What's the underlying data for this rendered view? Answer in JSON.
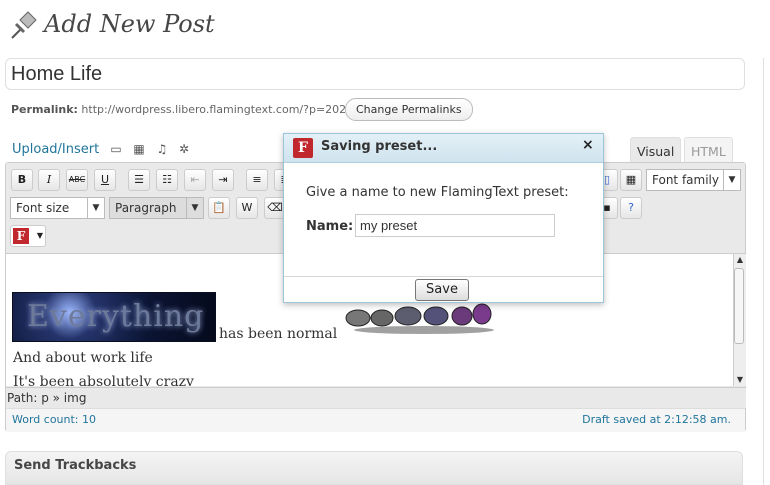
{
  "page": {
    "title": "Add New Post"
  },
  "post": {
    "title_value": "Home Life"
  },
  "permalink": {
    "label": "Permalink:",
    "url": "http://wordpress.libero.flamingtext.com/?p=202",
    "change_button": "Change Permalinks"
  },
  "media": {
    "upload_label": "Upload/Insert",
    "icons": [
      "image-icon",
      "video-icon",
      "audio-icon",
      "media-icon"
    ]
  },
  "tabs": {
    "visual": "Visual",
    "html": "HTML"
  },
  "toolbar": {
    "row1": [
      "B",
      "I",
      "ABC",
      "U"
    ],
    "font_family": "Font family",
    "font_size": "Font size",
    "format": "Paragraph"
  },
  "content": {
    "line1_suffix": "has been normal",
    "line2": "And about work life",
    "line3": "It's been absolutely crazy",
    "image_text": "Everything"
  },
  "pathbar": {
    "text": "Path: p » img"
  },
  "status": {
    "word_count": "Word count: 10",
    "draft_saved": "Draft saved at 2:12:58 am."
  },
  "trackbacks": {
    "title": "Send Trackbacks"
  },
  "dialog": {
    "title": "Saving preset...",
    "close": "×",
    "prompt": "Give a name to new FlamingText preset:",
    "name_label": "Name",
    "name_value": "my preset",
    "save_label": "Save"
  },
  "colors": {
    "accent": "#21759b",
    "flaming": "#c0282d"
  }
}
